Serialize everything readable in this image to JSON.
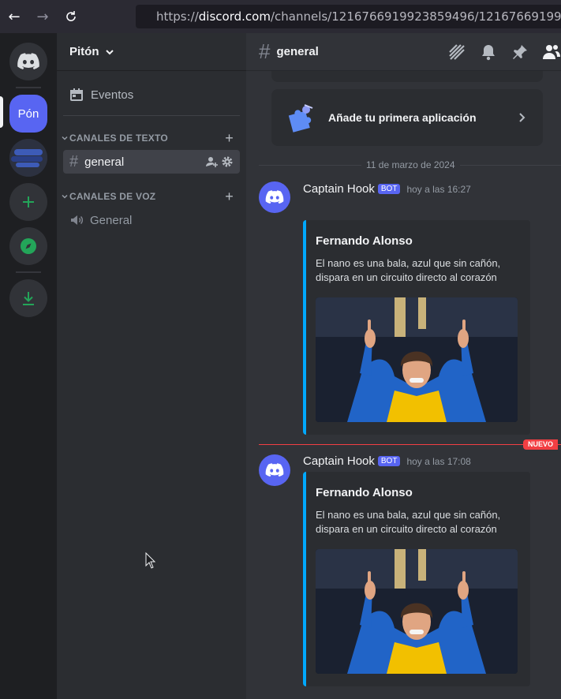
{
  "browser": {
    "url_prefix": "https://",
    "url_domain": "discord.com",
    "url_path": "/channels/1216766919923859496/1216766919923859"
  },
  "guilds": {
    "server_abbrev": "Pón"
  },
  "sidebar": {
    "server_name": "Pitón",
    "eventos_label": "Eventos",
    "categories": [
      {
        "label": "CANALES DE TEXTO",
        "channels": [
          {
            "label": "general"
          }
        ]
      },
      {
        "label": "CANALES DE VOZ",
        "channels": [
          {
            "label": "General"
          }
        ]
      }
    ]
  },
  "header": {
    "channel_name": "general"
  },
  "main": {
    "app_card_label": "Añade tu primera aplicación",
    "date_divider": "11 de marzo de 2024",
    "new_badge": "NUEVO",
    "messages": [
      {
        "author": "Captain Hook",
        "badge": "BOT",
        "time": "hoy a las 16:27",
        "embed_title": "Fernando Alonso",
        "embed_desc": "El nano es una bala, azul que sin cañón, dispara en un circuito directo al corazón"
      },
      {
        "author": "Captain Hook",
        "badge": "BOT",
        "time": "hoy a las 17:08",
        "embed_title": "Fernando Alonso",
        "embed_desc": "El nano es una bala, azul que sin cañón, dispara en un circuito directo al corazón"
      }
    ]
  },
  "colors": {
    "blurple": "#5865f2",
    "embed_bar": "#00a8fc",
    "new_red": "#f23f43",
    "green": "#23a559"
  }
}
